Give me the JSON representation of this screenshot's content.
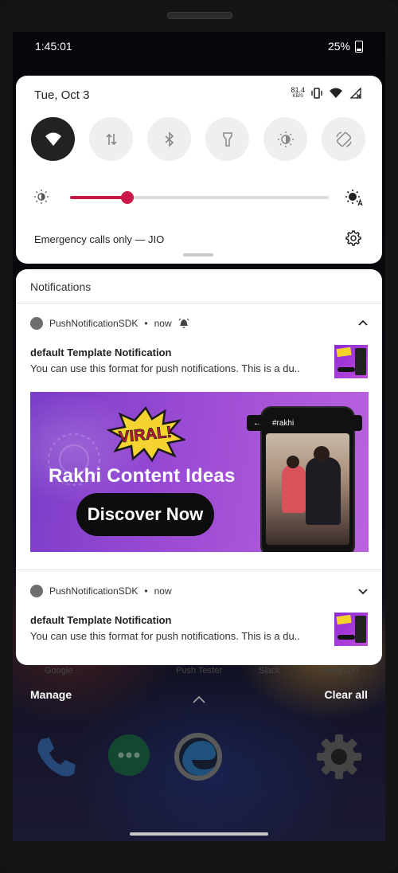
{
  "status_bar": {
    "time": "1:45:01",
    "battery": "25%"
  },
  "quick_settings": {
    "date": "Tue, Oct 3",
    "net_speed_value": "81.4",
    "net_speed_unit": "KB/S",
    "tiles": [
      {
        "icon": "wifi-icon",
        "active": true
      },
      {
        "icon": "mobile-data-icon",
        "active": false
      },
      {
        "icon": "bluetooth-icon",
        "active": false
      },
      {
        "icon": "flashlight-icon",
        "active": false
      },
      {
        "icon": "night-light-icon",
        "active": false
      },
      {
        "icon": "auto-rotate-icon",
        "active": false
      }
    ],
    "brightness_level": 0.22,
    "carrier_text": "Emergency calls only — JIO",
    "accent_color": "#c9184a"
  },
  "notifications": {
    "header": "Notifications",
    "items": [
      {
        "app_name": "PushNotificationSDK",
        "separator": "•",
        "time": "now",
        "title": "default Template Notification",
        "body": "You can use this format for push notifications. This is a du..",
        "expanded": true,
        "banner": {
          "burst_text": "VIRAL!",
          "headline": "Rakhi Content Ideas",
          "cta": "Discover Now",
          "search_label": "#rakhi",
          "thumb_text": "Discover Now"
        }
      },
      {
        "app_name": "PushNotificationSDK",
        "separator": "•",
        "time": "now",
        "title": "default Template Notification",
        "body": "You can use this format for push notifications. This is a du..",
        "expanded": false
      }
    ]
  },
  "background_labels": [
    "Google",
    "Push Tester",
    "Slack",
    "Telegraph"
  ],
  "actions": {
    "manage": "Manage",
    "clear_all": "Clear all"
  },
  "dock": [
    "phone-icon",
    "messages-icon",
    "edge-icon",
    "settings-icon"
  ]
}
